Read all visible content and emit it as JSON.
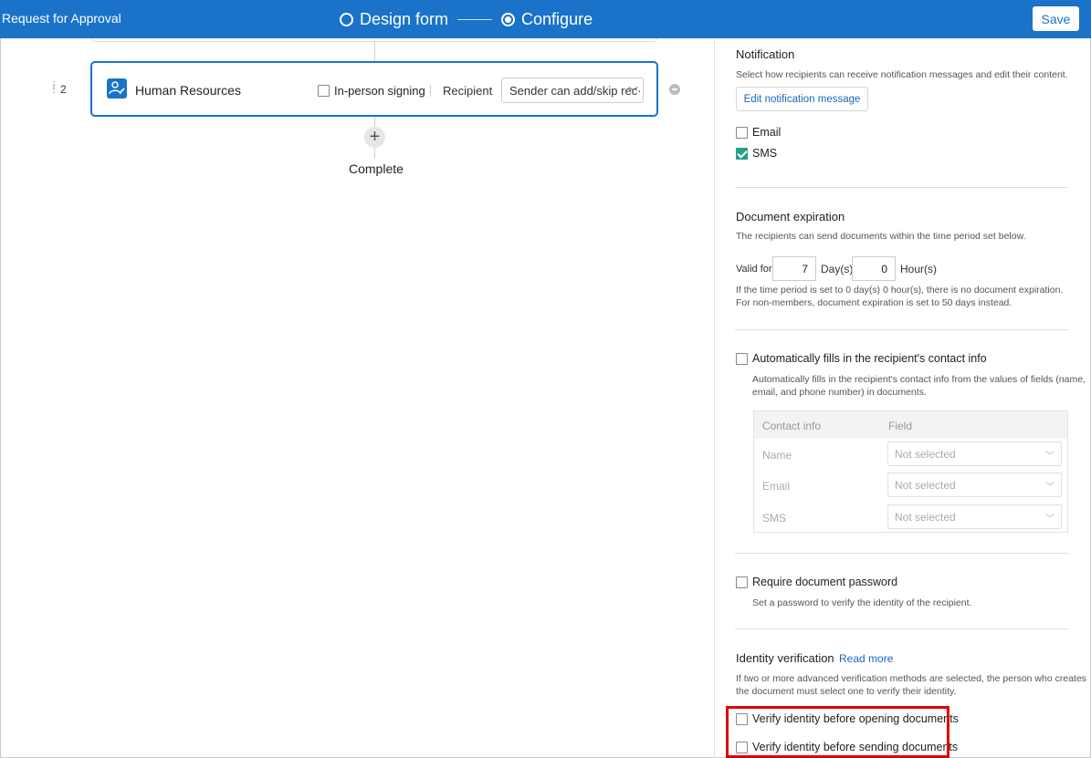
{
  "header": {
    "title": "Request for Approval",
    "steps": [
      {
        "label": "Design form",
        "state": "inactive"
      },
      {
        "label": "Configure",
        "state": "active"
      }
    ],
    "save_label": "Save",
    "bg_color": "#1a73c8"
  },
  "workflow": {
    "step": {
      "number": "2",
      "name": "Human Resources",
      "in_person_label": "In-person signing",
      "in_person_checked": false,
      "recipient_label": "Recipient",
      "recipient_value": "Sender can add/skip rec···"
    },
    "complete_label": "Complete"
  },
  "panel": {
    "notification": {
      "title": "Notification",
      "desc": "Select how recipients can receive notification messages and edit their content.",
      "edit_btn": "Edit notification message",
      "options": [
        {
          "label": "Email",
          "checked": false
        },
        {
          "label": "SMS",
          "checked": true
        }
      ]
    },
    "expiration": {
      "title": "Document expiration",
      "desc": "The recipients can send documents within the time period set below.",
      "valid_for": "Valid for",
      "days_value": "7",
      "days_unit": "Day(s)",
      "hours_value": "0",
      "hours_unit": "Hour(s)",
      "note1": "If the time period is set to 0 day(s) 0 hour(s), there is no document expiration.",
      "note2": "For non-members, document expiration is set to 50 days instead."
    },
    "autofill": {
      "label": "Automatically fills in the recipient's contact info",
      "checked": false,
      "desc1": "Automatically fills in the recipient's contact info from the values of fields (name,",
      "desc2": "email, and phone number) in documents.",
      "col_contact": "Contact info",
      "col_field": "Field",
      "rows": [
        {
          "label": "Name",
          "value": "Not selected"
        },
        {
          "label": "Email",
          "value": "Not selected"
        },
        {
          "label": "SMS",
          "value": "Not selected"
        }
      ]
    },
    "password": {
      "label": "Require document password",
      "checked": false,
      "desc": "Set a password to verify the identity of the recipient."
    },
    "identity": {
      "title": "Identity verification",
      "read_more": "Read more",
      "desc1": "If two or more advanced verification methods are selected, the person who creates",
      "desc2": "the document must select one to verify their identity.",
      "options": [
        {
          "label": "Verify identity before opening documents",
          "checked": false
        },
        {
          "label": "Verify identity before sending documents",
          "checked": false
        }
      ]
    }
  },
  "colors": {
    "accent": "#1a73c8",
    "check": "#23a08c",
    "highlight": "#e00000"
  }
}
